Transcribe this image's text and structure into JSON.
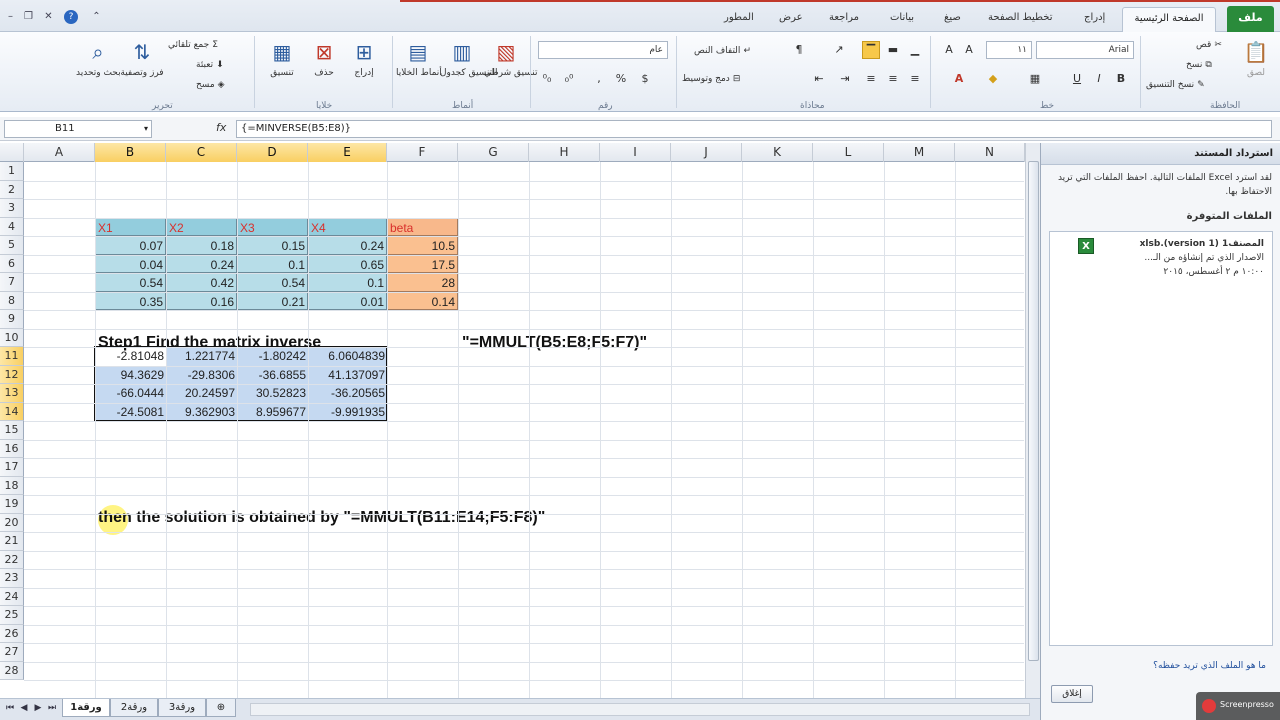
{
  "ribbon_tabs": [
    "ملف",
    "الصفحة الرئيسية",
    "إدراج",
    "تخطيط الصفحة",
    "صيغ",
    "بيانات",
    "مراجعة",
    "عرض",
    "المطور"
  ],
  "ribbon": {
    "clipboard": {
      "group": "الحافظة",
      "paste": "لصق",
      "cut": "قص",
      "copy": "نسخ",
      "format_painter": "نسخ التنسيق"
    },
    "font": {
      "group": "خط",
      "name": "Arial",
      "size": "١١"
    },
    "alignment": {
      "group": "محاذاة",
      "wrap": "التفاف النص",
      "merge": "دمج وتوسيط"
    },
    "number": {
      "group": "رقم",
      "format": "عام"
    },
    "styles": {
      "group": "أنماط",
      "conditional": "تنسيق شرطي",
      "table": "التنسيق كجدول",
      "cell": "أنماط الخلايا"
    },
    "cells": {
      "group": "خلايا",
      "insert": "إدراج",
      "delete": "حذف",
      "format": "تنسيق"
    },
    "editing": {
      "group": "تحرير",
      "autosum": "جمع تلقائي",
      "fill": "تعبئة",
      "clear": "مسح",
      "sort": "فرز وتصفية",
      "find": "بحث وتحديد"
    }
  },
  "formula_bar": {
    "name_box": "B11",
    "fx": "fx",
    "formula": "{=MINVERSE(B5:E8)}"
  },
  "columns": [
    "A",
    "B",
    "C",
    "D",
    "E",
    "F",
    "G",
    "H",
    "I",
    "J",
    "K",
    "L",
    "M",
    "N"
  ],
  "selected_columns": [
    "B",
    "C",
    "D",
    "E"
  ],
  "rows": [
    "1",
    "2",
    "3",
    "4",
    "5",
    "6",
    "7",
    "8",
    "9",
    "10",
    "11",
    "12",
    "13",
    "14",
    "15",
    "16",
    "17",
    "18",
    "19",
    "20",
    "21",
    "22",
    "23",
    "24",
    "25",
    "26",
    "27",
    "28"
  ],
  "selected_rows": [
    "11",
    "12",
    "13",
    "14"
  ],
  "table_headers": [
    "X1",
    "X2",
    "X3",
    "X4",
    "beta"
  ],
  "table_values": [
    [
      "0.07",
      "0.18",
      "0.15",
      "0.24",
      "10.5"
    ],
    [
      "0.04",
      "0.24",
      "0.1",
      "0.65",
      "17.5"
    ],
    [
      "0.54",
      "0.42",
      "0.54",
      "0.1",
      "28"
    ],
    [
      "0.35",
      "0.16",
      "0.21",
      "0.01",
      "0.14"
    ]
  ],
  "step_title": "Step1  Find the matrix inverse",
  "mmult_formula": "\"=MMULT(B5:E8;F5:F7)\"",
  "inverse": [
    [
      "-2.81048",
      "1.221774",
      "-1.80242",
      "6.0604839"
    ],
    [
      "94.3629",
      "-29.8306",
      "-36.6855",
      "41.137097"
    ],
    [
      "-66.0444",
      "20.24597",
      "30.52823",
      "-36.20565"
    ],
    [
      "-24.5081",
      "9.362903",
      "8.959677",
      "-9.991935"
    ]
  ],
  "solution_text": "then the solution is obtained by  \"=MMULT(B11:E14;F5:F8)\"",
  "sheet_tabs": [
    "ورقة1",
    "ورقة2",
    "ورقة3"
  ],
  "recovery_pane": {
    "title": "استرداد المستند",
    "description": "لقد استرد Excel الملفات التالية. احفظ الملفات التي تريد الاحتفاظ بها.",
    "section": "الملفات المتوفرة",
    "file_name": "المصنف1 (version 1).xlsb",
    "file_desc": "الاصدار الذي تم إنشاؤه من الـ...",
    "file_time": "١٠:٠٠ م ٢ أغسطس، ٢٠١٥",
    "link": "ما هو الملف الذي تريد حفظه؟",
    "close": "إغلاق"
  },
  "watermark": "Screenpresso"
}
